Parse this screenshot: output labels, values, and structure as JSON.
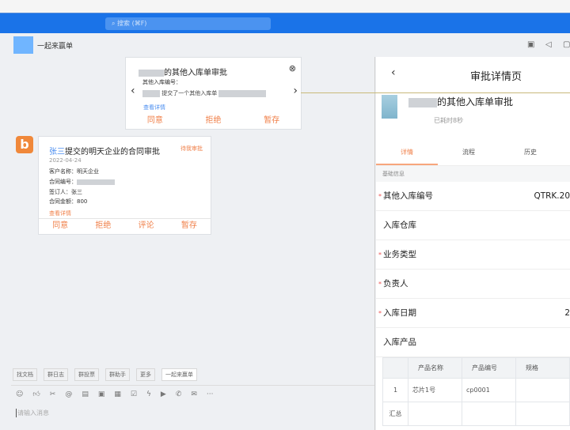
{
  "search": {
    "placeholder": "搜索 (⌘F)"
  },
  "chat": {
    "group_name": "一起来赢单",
    "header_icons": [
      "screen-share-icon",
      "speaker-icon",
      "window-icon"
    ]
  },
  "popup": {
    "title_suffix": "的其他入库单审批",
    "field_label": "其他入库编号：",
    "line": "提交了一个其他入库单",
    "link": "查看详情",
    "actions": [
      "同意",
      "拒绝",
      "暂存"
    ]
  },
  "card": {
    "avatar_letter": "b",
    "submitter": "张三",
    "title": "提交的明天企业的合同审批",
    "status": "待我审批",
    "date": "2022-04-24",
    "fields": [
      "客户名称：明天企业",
      "合同编号：",
      "签订人：张三",
      "合同金额：800"
    ],
    "link": "查看详情",
    "actions": [
      "同意",
      "拒绝",
      "评论",
      "暂存"
    ]
  },
  "quick_tags": [
    "找文档",
    "群日志",
    "群投票",
    "群助手",
    "更多",
    "一起来赢单"
  ],
  "toolbar_icons": [
    "emoji-icon",
    "thumbs-up-icon",
    "scissors-icon",
    "at-icon",
    "sticker-icon",
    "file-icon",
    "calendar-icon",
    "task-icon",
    "lightning-icon",
    "video-icon",
    "phone-icon",
    "mail-icon",
    "more-icon"
  ],
  "input": {
    "placeholder": "请输入消息"
  },
  "detail": {
    "title": "审批详情页",
    "name_suffix": "的其他入库单审批",
    "elapsed": "已耗时8秒",
    "tabs": [
      "详情",
      "流程",
      "历史"
    ],
    "section": "基础信息",
    "rows": [
      {
        "label": "其他入库编号",
        "required": true,
        "value": "QTRK.20"
      },
      {
        "label": "入库仓库",
        "required": false,
        "value": ""
      },
      {
        "label": "业务类型",
        "required": true,
        "value": ""
      },
      {
        "label": "负责人",
        "required": true,
        "value": ""
      },
      {
        "label": "入库日期",
        "required": true,
        "value": "2"
      },
      {
        "label": "入库产品",
        "required": false,
        "value": ""
      }
    ],
    "table": {
      "headers": [
        "",
        "产品名称",
        "产品编号",
        "规格"
      ],
      "rows": [
        [
          "1",
          "芯片1号",
          "cp0001",
          ""
        ],
        [
          "汇总",
          "",
          "",
          ""
        ]
      ]
    }
  },
  "colors": {
    "brand_blue": "#1a73e8",
    "accent_orange": "#f0804a",
    "link_blue": "#4a8df0"
  }
}
